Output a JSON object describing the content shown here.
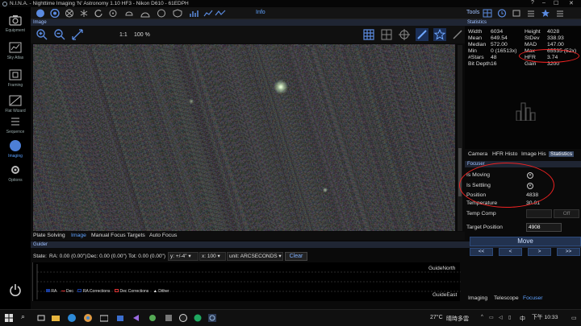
{
  "window": {
    "title": "N.I.N.A. - Nighttime Imaging 'N' Astronomy 1.10 HF3   -   Nikon D610 - 61EDPH",
    "help_glyph": "?",
    "min_glyph": "–",
    "max_glyph": "☐",
    "close_glyph": "✕"
  },
  "sidebar": {
    "items": [
      {
        "label": "Equipment",
        "icon": "camera-icon"
      },
      {
        "label": "Sky Atlas",
        "icon": "sky-atlas-icon"
      },
      {
        "label": "Framing",
        "icon": "framing-icon"
      },
      {
        "label": "Flat Wizard",
        "icon": "flat-wizard-icon"
      },
      {
        "label": "Sequence",
        "icon": "sequence-icon"
      },
      {
        "label": "Imaging",
        "icon": "imaging-icon"
      },
      {
        "label": "Options",
        "icon": "gear-icon"
      }
    ],
    "active": "Imaging"
  },
  "toolbar": {
    "info_label": "Info",
    "tools_label": "Tools"
  },
  "image_panel": {
    "header": "Image",
    "one_to_one": "1:1",
    "zoom": "100 %",
    "tabs": [
      "Plate Solving",
      "Image",
      "Manual Focus Targets",
      "Auto Focus"
    ],
    "active_tab": "Image"
  },
  "statistics": {
    "header": "Statistics",
    "rows": [
      {
        "l1": "Width",
        "v1": "6034",
        "l2": "Height",
        "v2": "4028"
      },
      {
        "l1": "Mean",
        "v1": "649.54",
        "l2": "StDev",
        "v2": "338.93"
      },
      {
        "l1": "Median",
        "v1": "572.00",
        "l2": "MAD",
        "v2": "147.00"
      },
      {
        "l1": "Min",
        "v1": "0 (16513x)",
        "l2": "Max",
        "v2": "65535 (52x)"
      },
      {
        "l1": "#Stars",
        "v1": "48",
        "l2": "HFR",
        "v2": "3.74"
      },
      {
        "l1": "Bit Depth",
        "v1": "16",
        "l2": "Gain",
        "v2": "3200"
      }
    ]
  },
  "right_tabs": {
    "items": [
      "Camera",
      "HFR Histo",
      "Image His",
      "Statistics"
    ],
    "active": "Statistics"
  },
  "focuser": {
    "header": "Focuser",
    "is_moving_label": "Is Moving",
    "is_settling_label": "Is Settling",
    "position_label": "Position",
    "position_value": "4838",
    "temperature_label": "Temperature",
    "temperature_value": "30.01",
    "temp_comp_label": "Temp Comp",
    "temp_comp_off": "Off",
    "target_label": "Target Position",
    "target_value": "4908",
    "move_label": "Move",
    "steps": [
      "<<",
      "<",
      ">",
      ">>"
    ]
  },
  "bottom_tabs": {
    "items": [
      "Imaging",
      "Telescope",
      "Focuser"
    ],
    "active": "Focuser"
  },
  "guider": {
    "header": "Guider",
    "state_label": "State:",
    "ra": "RA: 0.00 (0.00\")",
    "dec": "Dec: 0.00 (0.00\")",
    "tot": "Tot: 0.00 (0.00\")",
    "y_range": "y: +/-4\"",
    "x_range": "x: 100",
    "unit": "unit: ARCSECONDS",
    "clear": "Clear",
    "guide_north": "GuideNorth",
    "guide_east": "GuideEast",
    "legend": [
      "RA",
      "Dec",
      "RA Corrections",
      "Dec Corrections",
      "Dither"
    ]
  },
  "taskbar": {
    "temp": "27°C",
    "weather": "晴時多雲",
    "ime": "中",
    "time": "下午 10:33",
    "search_glyph": "⌕"
  },
  "colors": {
    "accent": "#5fa2ff",
    "annotation": "#e22222",
    "panel_header": "#1f2533"
  }
}
